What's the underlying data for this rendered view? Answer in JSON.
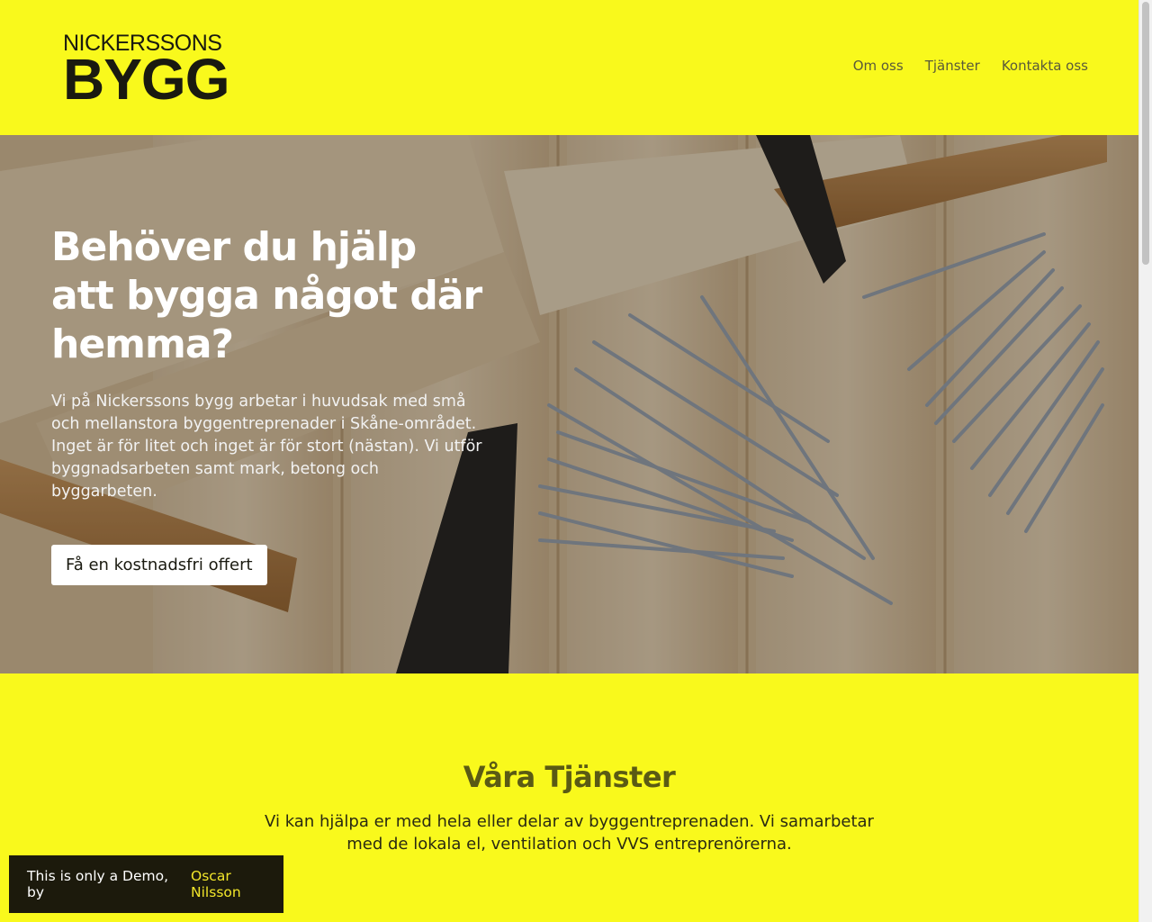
{
  "header": {
    "logo_top": "NICKERSSONS",
    "logo_main": "BYGG",
    "nav": [
      "Om oss",
      "Tjänster",
      "Kontakta oss"
    ]
  },
  "hero": {
    "title": "Behöver du hjälp att bygga något där hemma?",
    "text": "Vi på Nickerssons bygg arbetar i huvudsak med små och mellanstora byggentreprenader i Skåne-området. Inget är för litet och inget är för stort (nästan). Vi utför byggnadsarbeten samt mark, betong och byggarbeten.",
    "cta": "Få en kostnadsfri offert"
  },
  "services": {
    "title": "Våra Tjänster",
    "text": "Vi kan hjälpa er med hela eller delar av byggentreprenaden. Vi samarbetar med de lokala el, ventilation och VVS entreprenörerna."
  },
  "demo": {
    "prefix": "This is only a Demo, by",
    "author": "Oscar Nilsson"
  },
  "colors": {
    "brand_yellow": "#f9f91c",
    "dark": "#1c1a0c",
    "link_yellow": "#f2e62a"
  }
}
